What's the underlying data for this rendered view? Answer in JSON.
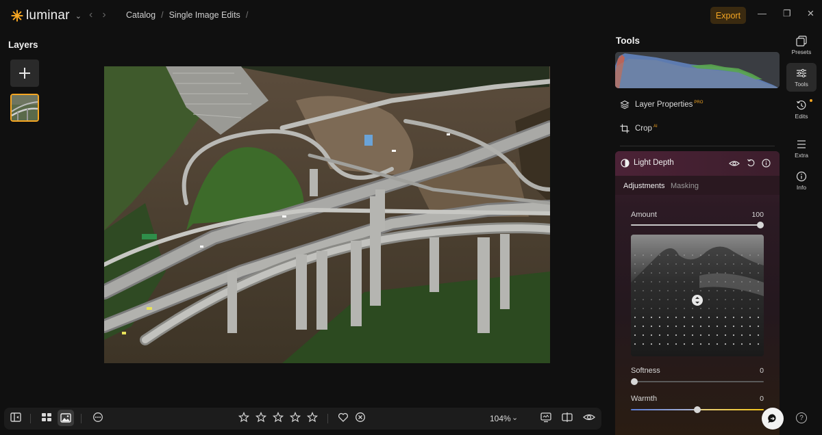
{
  "app": {
    "name": "luminar"
  },
  "breadcrumb": [
    "Catalog",
    "Single Image Edits"
  ],
  "header": {
    "export_label": "Export"
  },
  "layers": {
    "title": "Layers"
  },
  "toolbar": {
    "zoom": "104%",
    "rating_stars": 5
  },
  "tools": {
    "title": "Tools",
    "layer_properties": {
      "label": "Layer Properties",
      "badge": "PRO"
    },
    "crop": {
      "label": "Crop",
      "badge": "AI"
    },
    "light_depth": {
      "title": "Light Depth",
      "tabs": [
        "Adjustments",
        "Masking"
      ],
      "amount": {
        "label": "Amount",
        "value": "100",
        "fraction": 1.0
      },
      "softness": {
        "label": "Softness",
        "value": "0",
        "fraction": 0.0
      },
      "warmth": {
        "label": "Warmth",
        "value": "0",
        "fraction": 0.5
      }
    }
  },
  "rail": [
    {
      "label": "Presets",
      "icon": "presets-icon"
    },
    {
      "label": "Tools",
      "icon": "sliders-icon"
    },
    {
      "label": "Edits",
      "icon": "history-icon"
    },
    {
      "label": "Extra",
      "icon": "list-icon"
    },
    {
      "label": "Info",
      "icon": "info-icon"
    }
  ],
  "colors": {
    "accent": "#f5a623",
    "panel": "#101010"
  }
}
